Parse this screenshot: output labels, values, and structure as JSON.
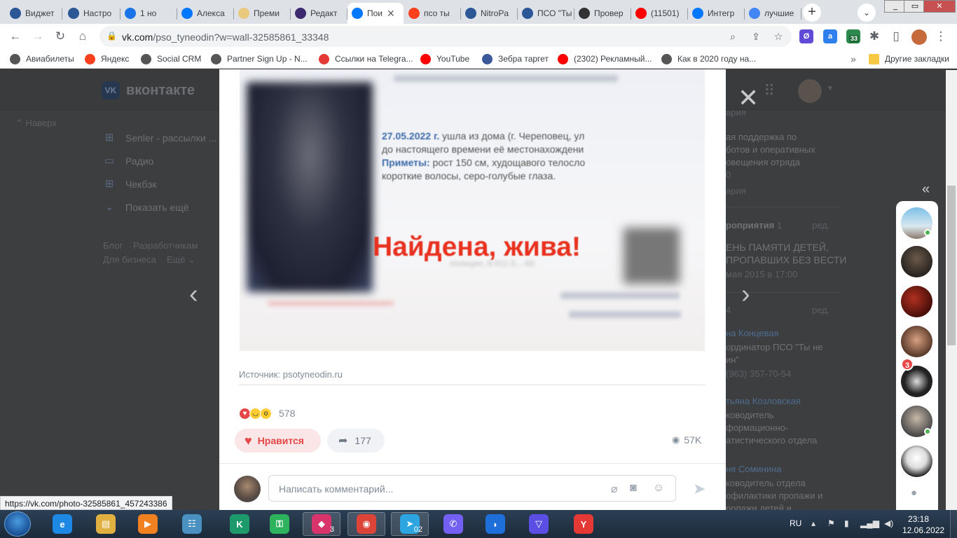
{
  "tabs": [
    {
      "title": "Виджет",
      "icon": "globe-icon",
      "color": "#2b5796"
    },
    {
      "title": "Настро",
      "icon": "globe-icon",
      "color": "#2b5796"
    },
    {
      "title": "1 но",
      "icon": "one-icon",
      "color": "#1a73e8"
    },
    {
      "title": "Алекса",
      "icon": "vk-icon",
      "color": "#0077ff"
    },
    {
      "title": "Преми",
      "icon": "coin-icon",
      "color": "#e8c97d"
    },
    {
      "title": "Редакт",
      "icon": "ob-icon",
      "color": "#3d2a6e"
    },
    {
      "title": "Пои",
      "icon": "vk-icon",
      "color": "#0077ff"
    },
    {
      "title": "псо ты",
      "icon": "yandex-icon",
      "color": "#fc3f1d"
    },
    {
      "title": "NitroPa",
      "icon": "globe-icon",
      "color": "#2b5796"
    },
    {
      "title": "ПСО \"Ты",
      "icon": "globe-icon",
      "color": "#2b5796"
    },
    {
      "title": "Провер",
      "icon": "code-icon",
      "color": "#333333"
    },
    {
      "title": "(11501)",
      "icon": "youtube-icon",
      "color": "#ff0000"
    },
    {
      "title": "Интегр",
      "icon": "vk-icon",
      "color": "#0077ff"
    },
    {
      "title": "лучшие",
      "icon": "google-icon",
      "color": "#4285f4"
    }
  ],
  "toolbar": {
    "url_host": "vk.com",
    "url_path": "/pso_tyneodin?w=wall-32585861_33348",
    "ext_badge": "33"
  },
  "bookmarks": [
    {
      "label": "Авиабилеты",
      "icon": "globe-icon",
      "color": "#555555"
    },
    {
      "label": "Яндекс",
      "icon": "yandex-icon",
      "color": "#fc3f1d"
    },
    {
      "label": "Social CRM",
      "icon": "globe-icon",
      "color": "#555555"
    },
    {
      "label": "Partner Sign Up - N...",
      "icon": "globe-icon",
      "color": "#555555"
    },
    {
      "label": "Ссылки на Telegra...",
      "icon": "t-icon",
      "color": "#e53935"
    },
    {
      "label": "YouTube",
      "icon": "youtube-icon",
      "color": "#ff0000"
    },
    {
      "label": "Зебра таргет",
      "icon": "z-icon",
      "color": "#3b5998"
    },
    {
      "label": "(2302) Рекламный...",
      "icon": "youtube-icon",
      "color": "#ff0000"
    },
    {
      "label": "Как в 2020 году на...",
      "icon": "globe-icon",
      "color": "#555555"
    }
  ],
  "bookmarks_other": "Другие закладки",
  "vk": {
    "brand": "вконтакте",
    "up_label": "Наверх",
    "left_menu": [
      {
        "label": "Senler - рассылки ...",
        "icon": "apps-icon"
      },
      {
        "label": "Радио",
        "icon": "radio-icon"
      },
      {
        "label": "Чекбэк",
        "icon": "apps-icon"
      },
      {
        "label": "Показать ещё",
        "icon": "chevron-down-icon"
      }
    ],
    "footer": {
      "blog": "Блог",
      "developers": "Разработчикам",
      "business": "Для бизнеса",
      "more": "Ещё"
    },
    "right": {
      "r1": "ария",
      "r2": "ая поддержка по",
      "r3": "ботов и оперативных",
      "r4": "овещения отряда",
      "r5": "0",
      "r6": "ария",
      "events_title": "роприятия",
      "events_count": "1",
      "edit1": "ред.",
      "event_name1": "ЕНЬ ПАМЯТИ ДЕТЕЙ,",
      "event_name2": "ПРОПАВШИХ БЕЗ ВЕСТИ",
      "event_date": "мая 2015 в 17:00",
      "contacts_count": "4",
      "edit2": "ред.",
      "c1_name": "на Концевая",
      "c1_role1": "ординатор ПСО \"Ты не",
      "c1_role2": "ин\"",
      "c1_phone": "(963) 357-70-54",
      "c2_name": "тьяна Козловская",
      "c2_role1": "ководитель",
      "c2_role2": "формационно-",
      "c2_role3": "атистического отдела",
      "c3_name": "ня Соминина",
      "c3_role1": "ководитель отдела",
      "c3_role2": "офилактики пропажи и",
      "c3_role3": "ропажи детей и"
    }
  },
  "post": {
    "photo_date": "27.05.2022 г.",
    "photo_line1": "ушла из дома (г. Череповец, ул",
    "photo_line2": "до настоящего времени её местонахождени",
    "photo_signs": "Приметы:",
    "photo_line3": "рост 150 см, худощавого телосло",
    "photo_line4": "короткие волосы, серо-голубые глаза.",
    "photo_found": "Найдена, жива!",
    "photo_phone": "полиция, 8-911-5...-65",
    "source": "Источник: psotyneodin.ru",
    "reactions": [
      "heart",
      "cry",
      "wow"
    ],
    "reaction_count": "578",
    "like_label": "Нравится",
    "share_count": "177",
    "views": "57K",
    "comment_placeholder": "Написать комментарий..."
  },
  "chats": {
    "unread_badge": "3"
  },
  "status_url": "https://vk.com/photo-32585861_457243386",
  "taskbar": {
    "apps": [
      {
        "name": "ie-icon",
        "label": "e",
        "color": "#1e88e5",
        "open": false
      },
      {
        "name": "explorer-icon",
        "label": "▤",
        "color": "#e0b040",
        "open": false
      },
      {
        "name": "media-icon",
        "label": "▶",
        "color": "#f08020",
        "open": false
      },
      {
        "name": "control-panel-icon",
        "label": "☷",
        "color": "#4a90c0",
        "open": false
      },
      {
        "name": "kaspersky-icon",
        "label": "K",
        "color": "#1d9a6c",
        "open": false
      },
      {
        "name": "keepass-icon",
        "label": "⚿",
        "color": "#2db35d",
        "open": false
      },
      {
        "name": "app-3-icon",
        "label": "◆",
        "color": "#d9336b",
        "open": true,
        "count": "3"
      },
      {
        "name": "chrome-icon",
        "label": "◉",
        "color": "#db4437",
        "open": true
      },
      {
        "name": "telegram-icon",
        "label": "➤",
        "color": "#2ca5e0",
        "open": true,
        "count": "02"
      },
      {
        "name": "viber-icon",
        "label": "✆",
        "color": "#7360f2",
        "open": false
      },
      {
        "name": "app-blue-icon",
        "label": "◗",
        "color": "#1e6fd9",
        "open": false
      },
      {
        "name": "vpn-icon",
        "label": "▽",
        "color": "#5b4ee5",
        "open": false
      },
      {
        "name": "yandex-browser-icon",
        "label": "Y",
        "color": "#e53935",
        "open": false
      }
    ],
    "lang": "RU",
    "time": "23:18",
    "date": "12.06.2022"
  }
}
